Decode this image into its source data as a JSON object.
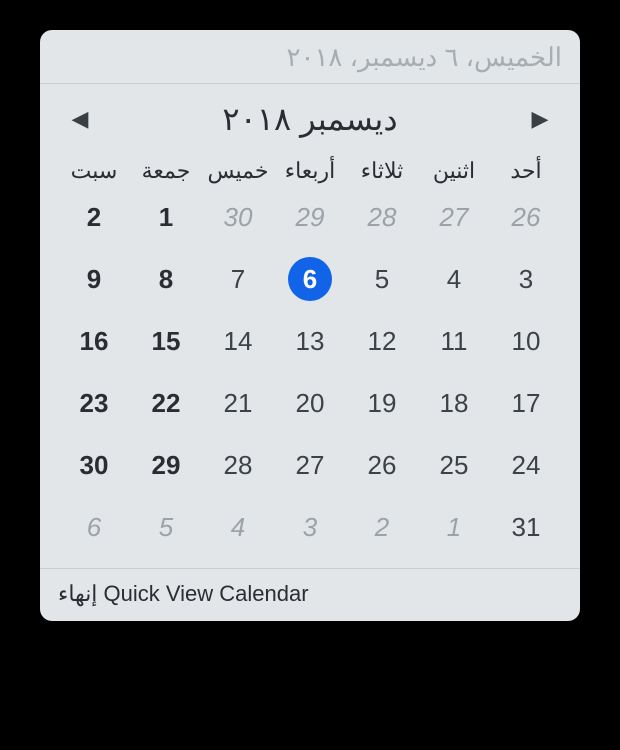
{
  "header": {
    "date_text": "الخميس، ٦ ديسمبر، ٢٠١٨"
  },
  "nav": {
    "prev_icon": "◀",
    "next_icon": "▶",
    "month_label": "ديسمبر ٢٠١٨"
  },
  "day_headers": [
    "أحد",
    "اثنين",
    "ثلاثاء",
    "أربعاء",
    "خميس",
    "جمعة",
    "سبت"
  ],
  "weeks": [
    [
      {
        "n": "26",
        "other": true
      },
      {
        "n": "27",
        "other": true
      },
      {
        "n": "28",
        "other": true
      },
      {
        "n": "29",
        "other": true
      },
      {
        "n": "30",
        "other": true
      },
      {
        "n": "1",
        "weekend": true
      },
      {
        "n": "2",
        "weekend": true
      }
    ],
    [
      {
        "n": "3"
      },
      {
        "n": "4"
      },
      {
        "n": "5"
      },
      {
        "n": "6",
        "today": true
      },
      {
        "n": "7"
      },
      {
        "n": "8",
        "weekend": true
      },
      {
        "n": "9",
        "weekend": true
      }
    ],
    [
      {
        "n": "10"
      },
      {
        "n": "11"
      },
      {
        "n": "12"
      },
      {
        "n": "13"
      },
      {
        "n": "14"
      },
      {
        "n": "15",
        "weekend": true
      },
      {
        "n": "16",
        "weekend": true
      }
    ],
    [
      {
        "n": "17"
      },
      {
        "n": "18"
      },
      {
        "n": "19"
      },
      {
        "n": "20"
      },
      {
        "n": "21"
      },
      {
        "n": "22",
        "weekend": true
      },
      {
        "n": "23",
        "weekend": true
      }
    ],
    [
      {
        "n": "24"
      },
      {
        "n": "25"
      },
      {
        "n": "26"
      },
      {
        "n": "27"
      },
      {
        "n": "28"
      },
      {
        "n": "29",
        "weekend": true
      },
      {
        "n": "30",
        "weekend": true
      }
    ],
    [
      {
        "n": "31"
      },
      {
        "n": "1",
        "other": true
      },
      {
        "n": "2",
        "other": true
      },
      {
        "n": "3",
        "other": true
      },
      {
        "n": "4",
        "other": true
      },
      {
        "n": "5",
        "other": true
      },
      {
        "n": "6",
        "other": true
      }
    ]
  ],
  "footer": {
    "quit_label": "إنهاء Quick View Calendar"
  },
  "colors": {
    "accent": "#1164e8",
    "bg": "#e2e6e9"
  }
}
